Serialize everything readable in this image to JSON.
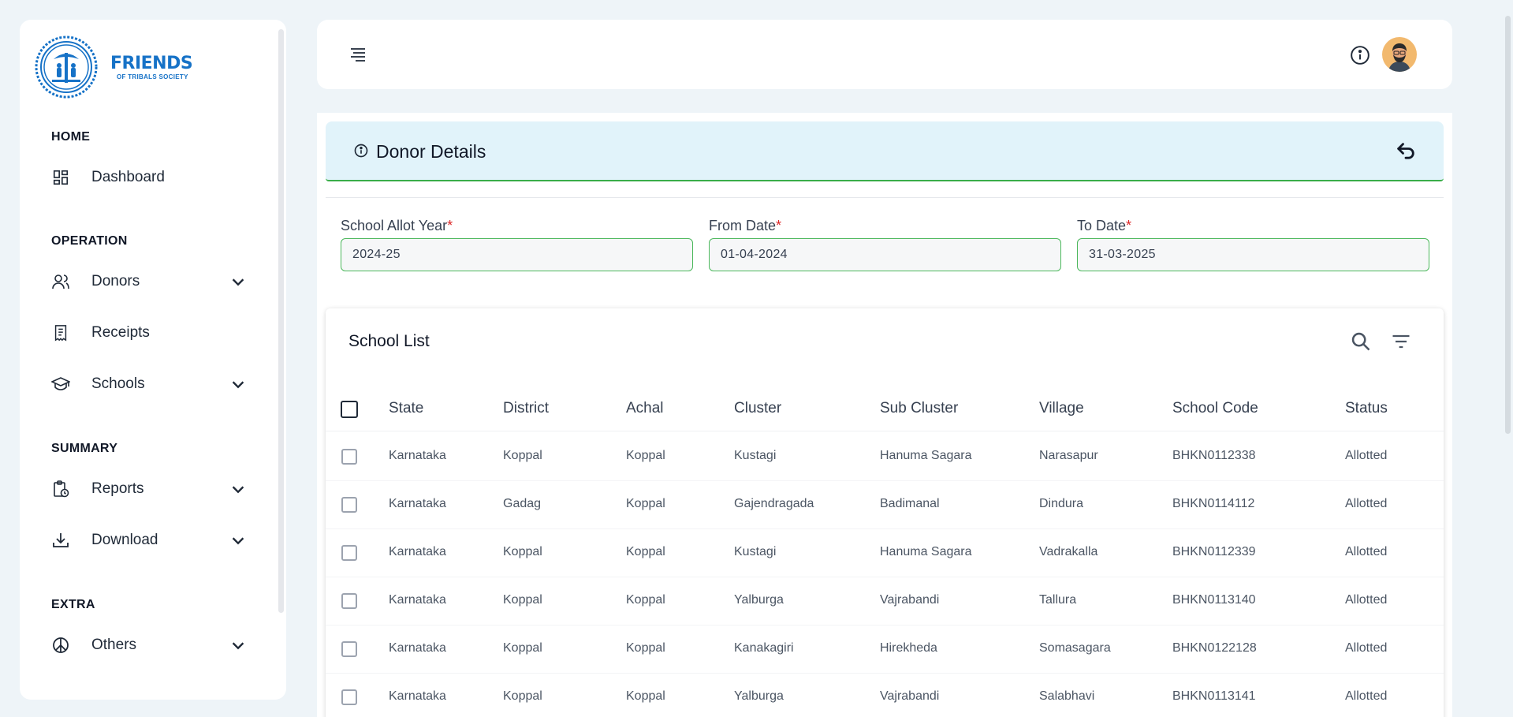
{
  "brand": {
    "name": "FRIENDS",
    "subtitle": "OF TRIBALS SOCIETY",
    "color": "#1672c7"
  },
  "sidebar": {
    "sections": [
      {
        "title": "HOME"
      },
      {
        "title": "OPERATION"
      },
      {
        "title": "SUMMARY"
      },
      {
        "title": "EXTRA"
      }
    ],
    "items": [
      {
        "label": "Dashboard",
        "icon": "dashboard-icon"
      },
      {
        "label": "Donors",
        "icon": "users-icon",
        "expandable": true
      },
      {
        "label": "Receipts",
        "icon": "receipt-icon"
      },
      {
        "label": "Schools",
        "icon": "graduation-cap-icon",
        "expandable": true
      },
      {
        "label": "Reports",
        "icon": "clipboard-clock-icon",
        "expandable": true
      },
      {
        "label": "Download",
        "icon": "download-icon",
        "expandable": true
      },
      {
        "label": "Others",
        "icon": "peace-icon",
        "expandable": true
      }
    ]
  },
  "topbar": {
    "menu_icon": "menu-icon",
    "info_icon": "info-icon",
    "avatar": "user-avatar"
  },
  "page": {
    "title": "Donor Details",
    "title_icon": "info-icon",
    "back_icon": "return-icon",
    "accent": "#3aad4a",
    "banner_color": "#e1f3fa"
  },
  "form": {
    "fields": [
      {
        "label": "School Allot Year",
        "required_mark": "*",
        "value": "2024-25"
      },
      {
        "label": "From Date",
        "required_mark": "*",
        "value": "01-04-2024"
      },
      {
        "label": "To Date",
        "required_mark": "*",
        "value": "31-03-2025"
      }
    ]
  },
  "table": {
    "title": "School List",
    "columns": [
      "State",
      "District",
      "Achal",
      "Cluster",
      "Sub Cluster",
      "Village",
      "School Code",
      "Status"
    ],
    "rows": [
      [
        "Karnataka",
        "Koppal",
        "Koppal",
        "Kustagi",
        "Hanuma Sagara",
        "Narasapur",
        "BHKN0112338",
        "Allotted"
      ],
      [
        "Karnataka",
        "Gadag",
        "Koppal",
        "Gajendragada",
        "Badimanal",
        "Dindura",
        "BHKN0114112",
        "Allotted"
      ],
      [
        "Karnataka",
        "Koppal",
        "Koppal",
        "Kustagi",
        "Hanuma Sagara",
        "Vadrakalla",
        "BHKN0112339",
        "Allotted"
      ],
      [
        "Karnataka",
        "Koppal",
        "Koppal",
        "Yalburga",
        "Vajrabandi",
        "Tallura",
        "BHKN0113140",
        "Allotted"
      ],
      [
        "Karnataka",
        "Koppal",
        "Koppal",
        "Kanakagiri",
        "Hirekheda",
        "Somasagara",
        "BHKN0122128",
        "Allotted"
      ],
      [
        "Karnataka",
        "Koppal",
        "Koppal",
        "Yalburga",
        "Vajrabandi",
        "Salabhavi",
        "BHKN0113141",
        "Allotted"
      ]
    ]
  }
}
